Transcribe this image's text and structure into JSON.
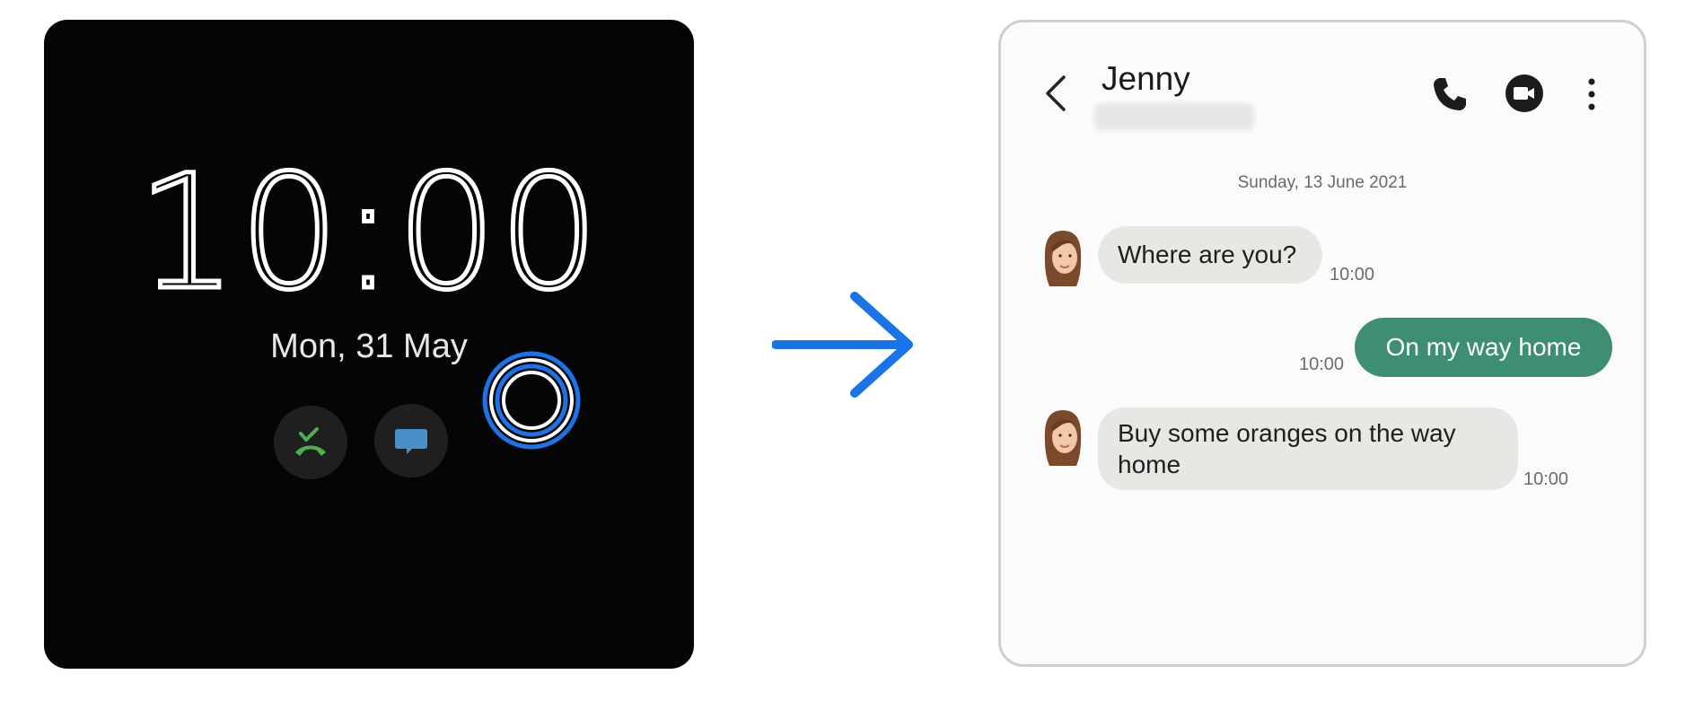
{
  "cover_screen": {
    "time_hours": "10",
    "time_minutes": "00",
    "date": "Mon, 31 May",
    "icons": [
      "missed-call-icon",
      "message-icon"
    ],
    "accent_colors": {
      "missed_call": "#4caf50",
      "message": "#4a90c8",
      "touch_ring": "#1a73e8"
    }
  },
  "transition": {
    "icon": "arrow-right-icon",
    "color": "#1a73e8"
  },
  "conversation": {
    "contact_name": "Jenny",
    "date_separator": "Sunday, 13 June 2021",
    "header_icons": [
      "back-icon",
      "phone-icon",
      "video-call-icon",
      "more-options-icon"
    ],
    "messages": [
      {
        "direction": "incoming",
        "text": "Where are you?",
        "time": "10:00"
      },
      {
        "direction": "outgoing",
        "text": "On my way home",
        "time": "10:00"
      },
      {
        "direction": "incoming",
        "text": "Buy some oranges on the way home",
        "time": "10:00"
      }
    ],
    "colors": {
      "outgoing_bubble": "#3e8f72",
      "incoming_bubble": "#e8e7e4"
    }
  }
}
